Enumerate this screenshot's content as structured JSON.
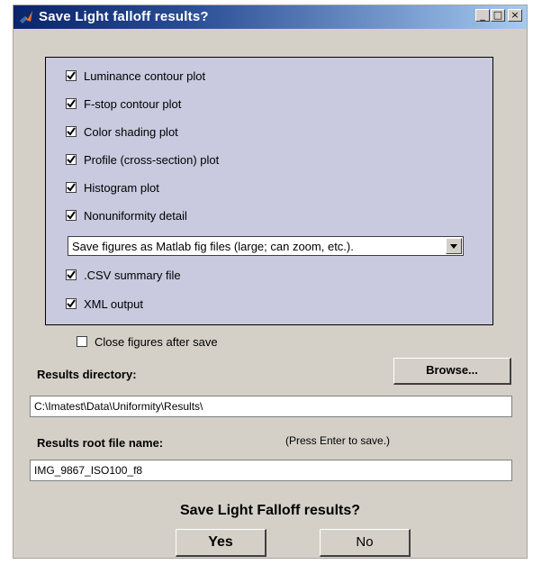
{
  "window": {
    "title": "Save Light falloff results?",
    "controls": {
      "minimize": "_",
      "maximize": "□",
      "close": "×"
    }
  },
  "options": [
    {
      "label": "Luminance contour plot",
      "checked": true
    },
    {
      "label": "F-stop contour plot",
      "checked": true
    },
    {
      "label": "Color shading plot",
      "checked": true
    },
    {
      "label": "Profile (cross-section) plot",
      "checked": true
    },
    {
      "label": "Histogram plot",
      "checked": true
    },
    {
      "label": "Nonuniformity detail",
      "checked": true
    }
  ],
  "figure_format": {
    "selected": "Save figures as Matlab fig files (large; can zoom, etc.)."
  },
  "extra_options": [
    {
      "label": ".CSV summary file",
      "checked": true
    },
    {
      "label": "XML output",
      "checked": true
    }
  ],
  "close_figures": {
    "label": "Close figures after save",
    "checked": false
  },
  "results_directory": {
    "label": "Results directory:",
    "browse_label": "Browse...",
    "value": "C:\\Imatest\\Data\\Uniformity\\Results\\"
  },
  "results_root": {
    "label": "Results root file name:",
    "hint": "(Press Enter to save.)",
    "value": "IMG_9867_ISO100_f8"
  },
  "prompt": "Save Light Falloff results?",
  "buttons": {
    "yes": "Yes",
    "no": "No"
  }
}
